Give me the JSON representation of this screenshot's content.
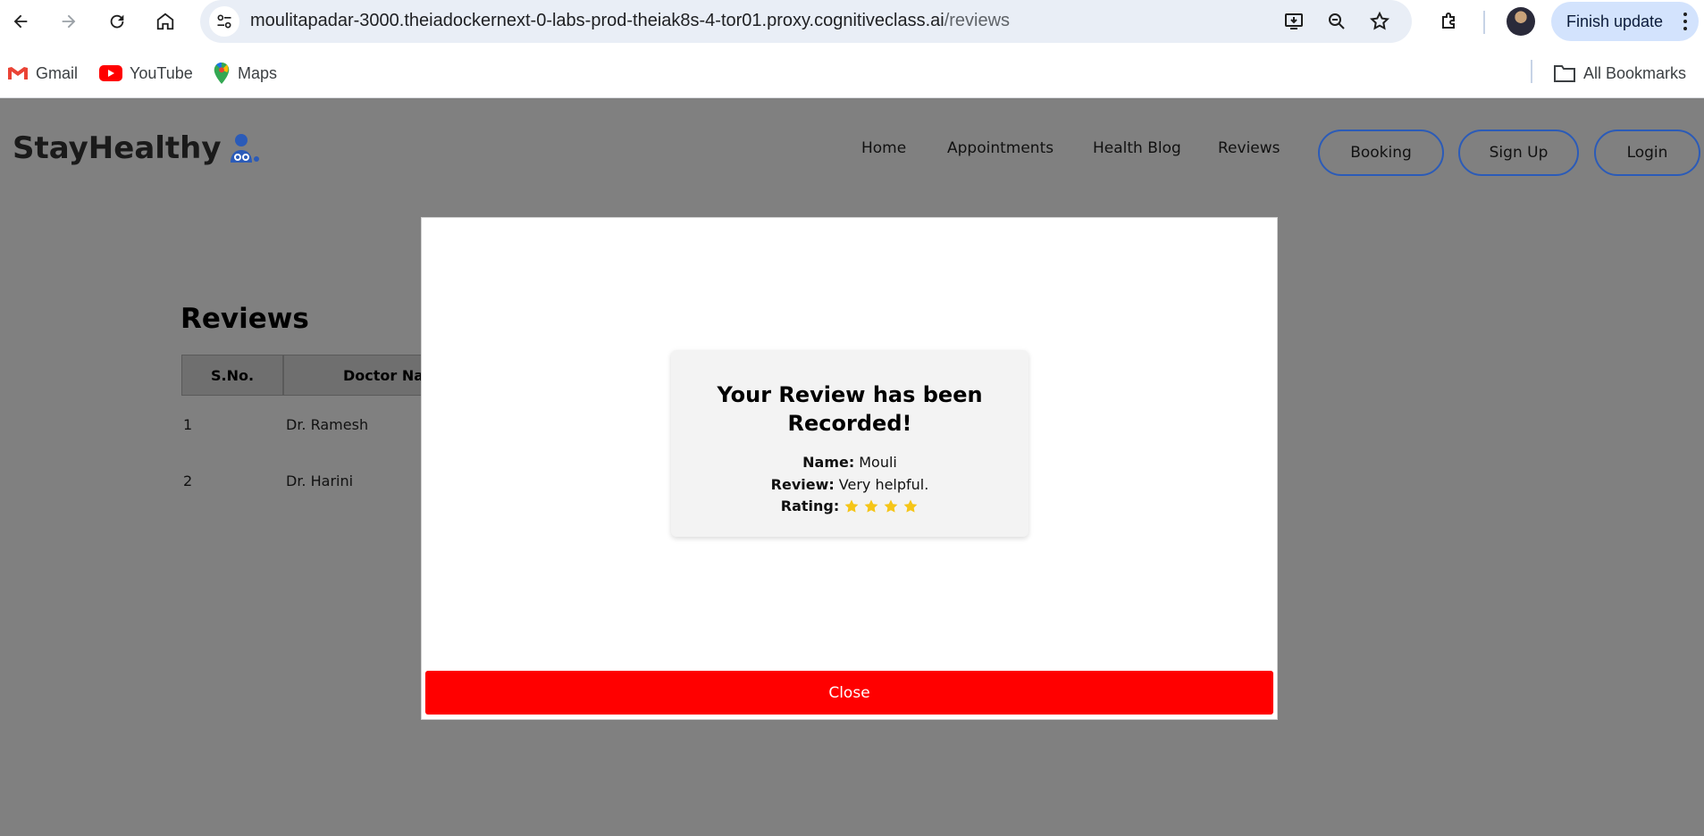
{
  "browser": {
    "url_host": "moulitapadar-3000.theiadockernext-0-labs-prod-theiak8s-4-tor01.proxy.cognitiveclass.ai",
    "url_path": "/reviews",
    "finish_update_label": "Finish update",
    "bookmarks": [
      {
        "label": "Gmail",
        "icon": "gmail-icon"
      },
      {
        "label": "YouTube",
        "icon": "youtube-icon"
      },
      {
        "label": "Maps",
        "icon": "maps-icon"
      }
    ],
    "all_bookmarks_label": "All Bookmarks"
  },
  "site": {
    "logo_text": "StayHealthy",
    "nav_links": [
      "Home",
      "Appointments",
      "Health Blog",
      "Reviews"
    ],
    "nav_buttons": [
      "Booking",
      "Sign Up",
      "Login"
    ]
  },
  "reviews": {
    "title": "Reviews",
    "columns": [
      "S.No.",
      "Doctor Nar"
    ],
    "rows": [
      {
        "sno": "1",
        "doctor": "Dr. Ramesh"
      },
      {
        "sno": "2",
        "doctor": "Dr. Harini"
      }
    ]
  },
  "modal": {
    "title": "Your Review has been Recorded!",
    "name_label": "Name:",
    "name_value": "Mouli",
    "review_label": "Review:",
    "review_value": "Very helpful.",
    "rating_label": "Rating:",
    "rating_value": 4,
    "rating_max": 4,
    "close_label": "Close"
  },
  "colors": {
    "overlay": "#808080",
    "close_button": "#ff0000",
    "pill_border": "#2b5bb8",
    "star": "#f5c518",
    "finish_update_bg": "#d3e3fd"
  }
}
